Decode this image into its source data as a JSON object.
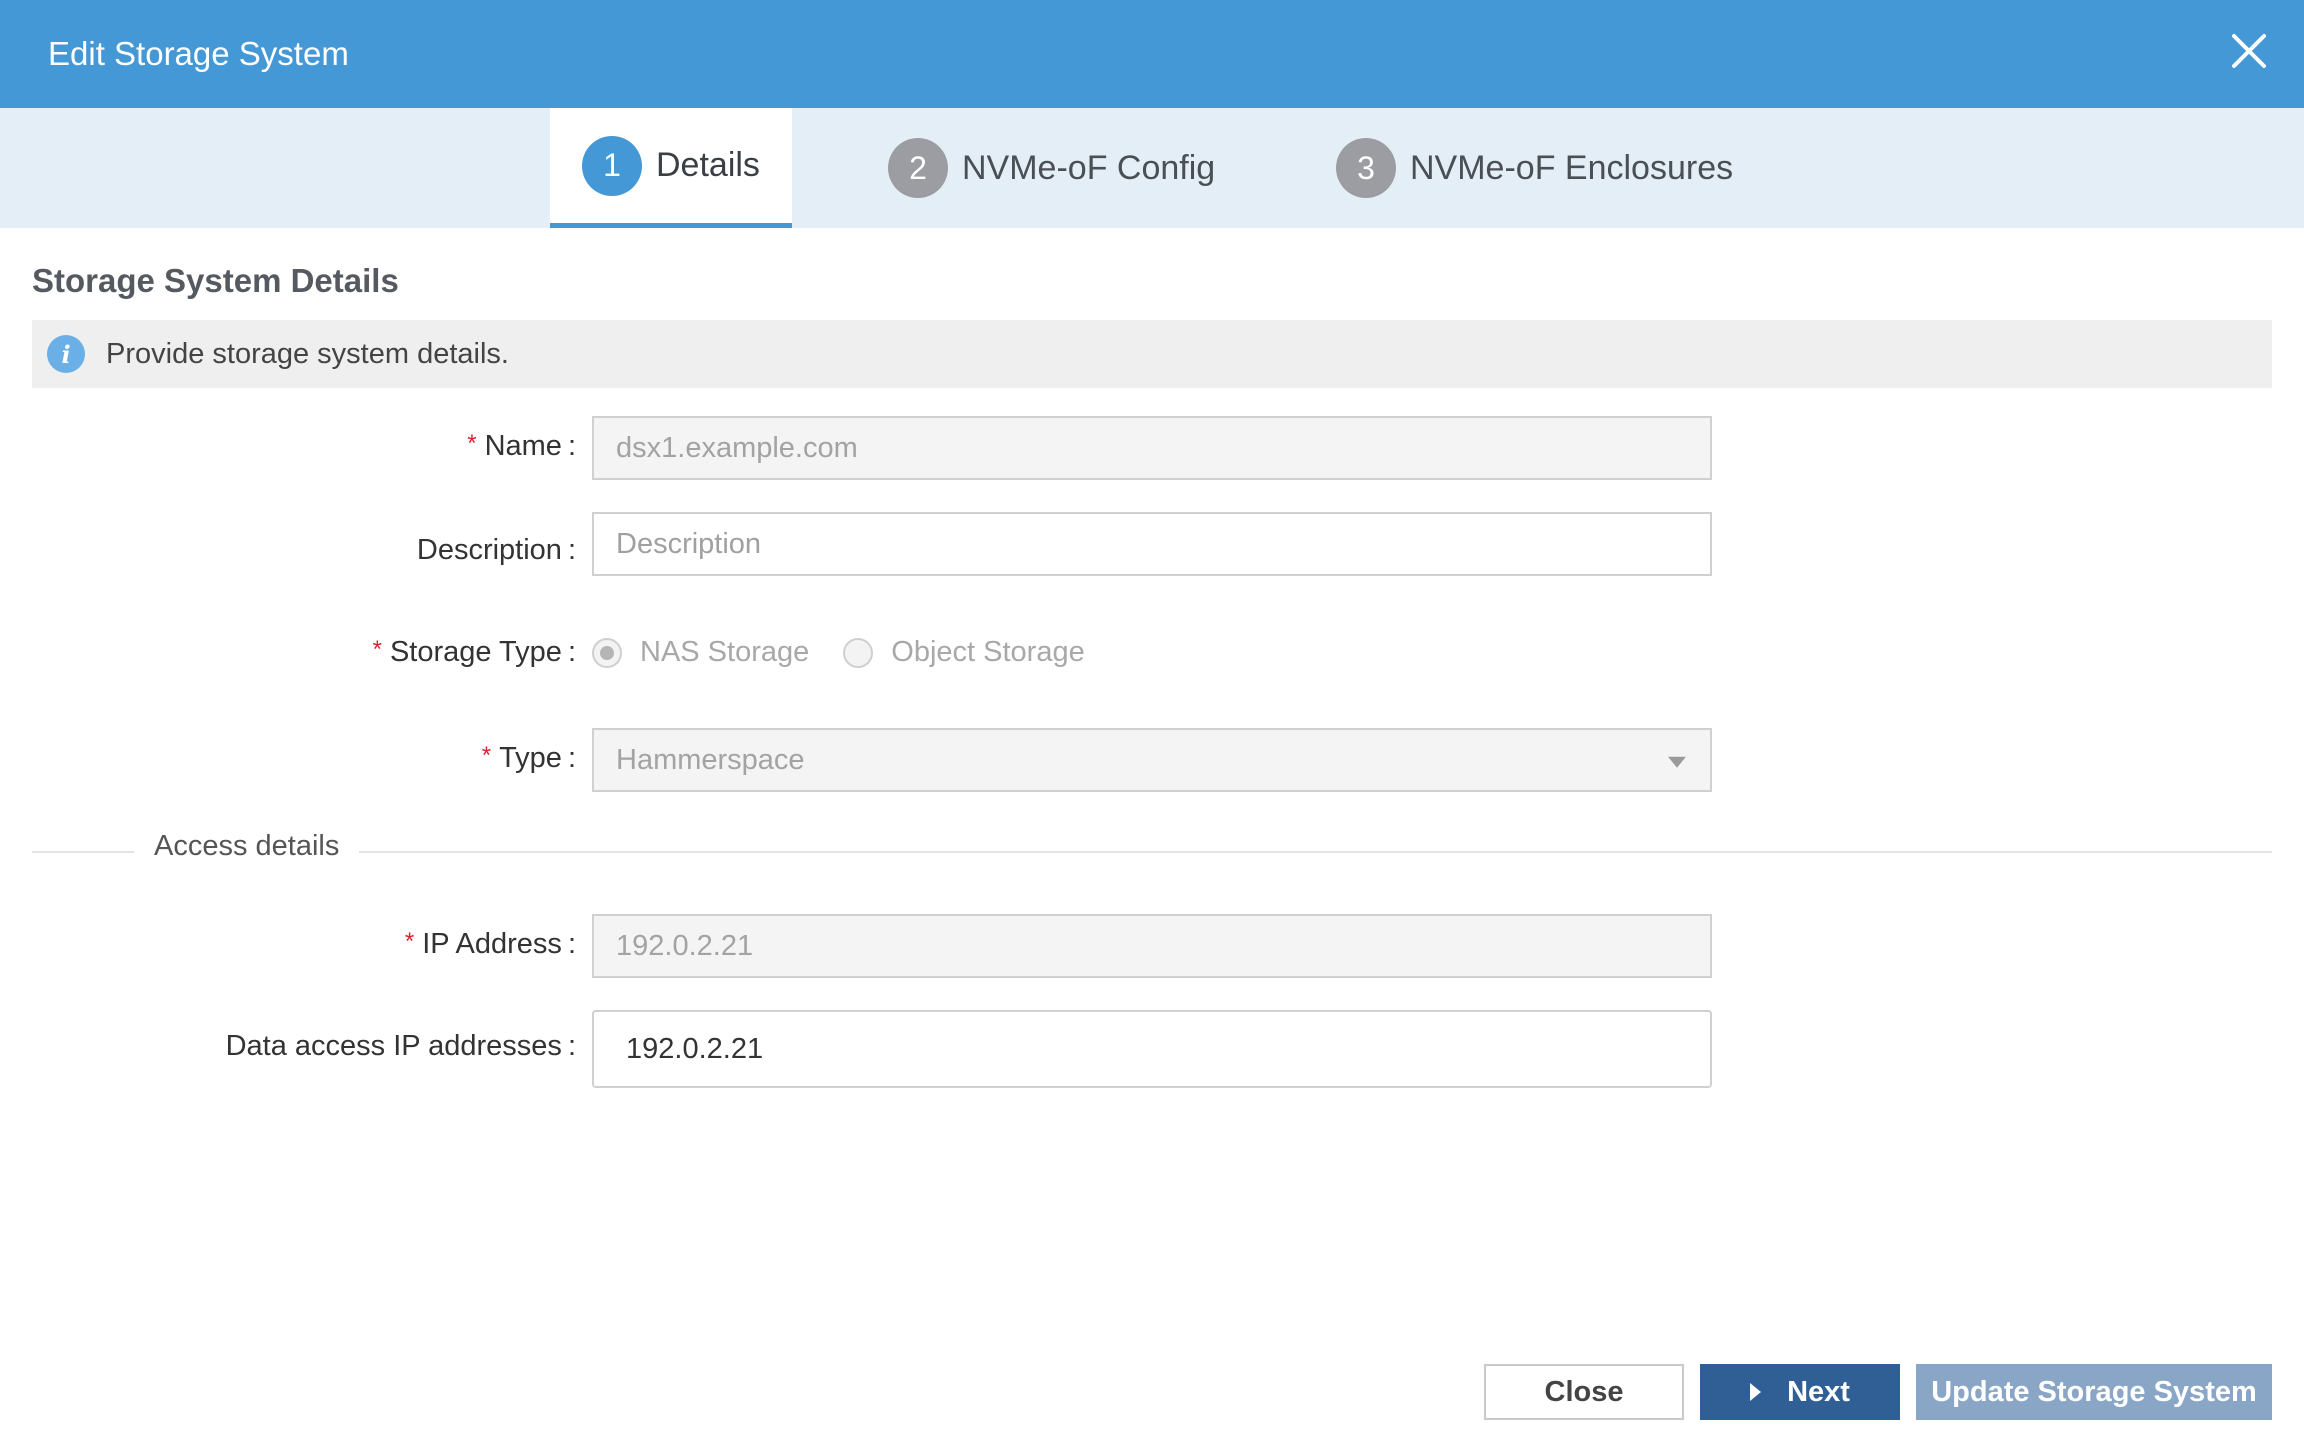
{
  "dialog": {
    "title": "Edit Storage System"
  },
  "steps": [
    {
      "number": "1",
      "label": "Details",
      "active": true
    },
    {
      "number": "2",
      "label": "NVMe-oF Config",
      "active": false
    },
    {
      "number": "3",
      "label": "NVMe-oF Enclosures",
      "active": false
    }
  ],
  "section": {
    "title": "Storage System Details",
    "info": "Provide storage system details."
  },
  "form": {
    "name": {
      "label": "Name",
      "required": "*",
      "value": "dsx1.example.com"
    },
    "description": {
      "label": "Description",
      "placeholder": "Description"
    },
    "storage_type": {
      "label": "Storage Type",
      "required": "*",
      "options": [
        "NAS Storage",
        "Object Storage"
      ],
      "selected": "NAS Storage"
    },
    "type": {
      "label": "Type",
      "required": "*",
      "value": "Hammerspace"
    },
    "access_details_title": "Access details",
    "ip_address": {
      "label": "IP Address",
      "required": "*",
      "value": "192.0.2.21"
    },
    "data_access_ips": {
      "label": "Data access IP addresses",
      "value": "192.0.2.21"
    },
    "colon": ":"
  },
  "buttons": {
    "close": "Close",
    "next": "Next",
    "update": "Update Storage System"
  },
  "colors": {
    "header": "#4498d6",
    "step_bar": "#e4eef6",
    "next_button": "#2f5f95",
    "update_button": "#8aa6c7",
    "required": "#d9232e"
  }
}
